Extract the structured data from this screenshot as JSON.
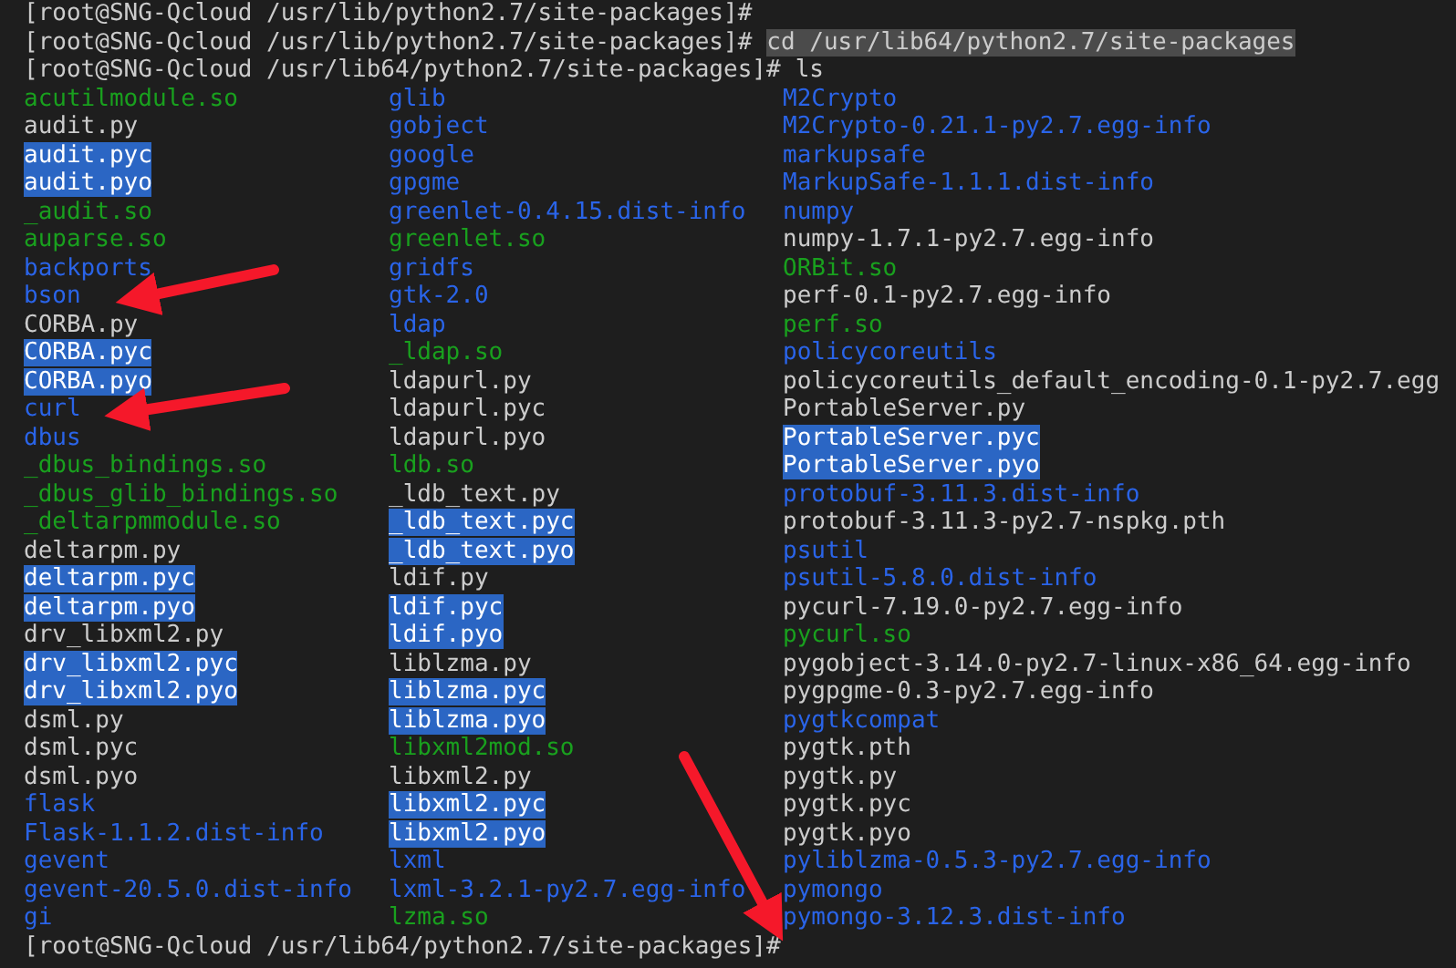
{
  "terminal": {
    "lines": [
      {
        "prompt": "[root@SNG-Qcloud /usr/lib/python2.7/site-packages]#"
      },
      {
        "prompt": "[root@SNG-Qcloud /usr/lib/python2.7/site-packages]#",
        "command": "cd /usr/lib64/python2.7/site-packages",
        "selected": true
      },
      {
        "prompt": "[root@SNG-Qcloud /usr/lib64/python2.7/site-packages]#",
        "command": "ls",
        "selected": false
      }
    ],
    "listing": [
      [
        {
          "name": "acutilmodule.so",
          "kind": "library"
        },
        {
          "name": "audit.py",
          "kind": "file"
        },
        {
          "name": "audit.pyc",
          "kind": "compiled"
        },
        {
          "name": "audit.pyo",
          "kind": "compiled"
        },
        {
          "name": "_audit.so",
          "kind": "library"
        },
        {
          "name": "auparse.so",
          "kind": "library"
        },
        {
          "name": "backports",
          "kind": "directory"
        },
        {
          "name": "bson",
          "kind": "directory"
        },
        {
          "name": "CORBA.py",
          "kind": "file"
        },
        {
          "name": "CORBA.pyc",
          "kind": "compiled"
        },
        {
          "name": "CORBA.pyo",
          "kind": "compiled"
        },
        {
          "name": "curl",
          "kind": "directory"
        },
        {
          "name": "dbus",
          "kind": "directory"
        },
        {
          "name": "_dbus_bindings.so",
          "kind": "library"
        },
        {
          "name": "_dbus_glib_bindings.so",
          "kind": "library"
        },
        {
          "name": "_deltarpmmodule.so",
          "kind": "library"
        },
        {
          "name": "deltarpm.py",
          "kind": "file"
        },
        {
          "name": "deltarpm.pyc",
          "kind": "compiled"
        },
        {
          "name": "deltarpm.pyo",
          "kind": "compiled"
        },
        {
          "name": "drv_libxml2.py",
          "kind": "file"
        },
        {
          "name": "drv_libxml2.pyc",
          "kind": "compiled"
        },
        {
          "name": "drv_libxml2.pyo",
          "kind": "compiled"
        },
        {
          "name": "dsml.py",
          "kind": "file"
        },
        {
          "name": "dsml.pyc",
          "kind": "file"
        },
        {
          "name": "dsml.pyo",
          "kind": "file"
        },
        {
          "name": "flask",
          "kind": "directory"
        },
        {
          "name": "Flask-1.1.2.dist-info",
          "kind": "directory"
        },
        {
          "name": "gevent",
          "kind": "directory"
        },
        {
          "name": "gevent-20.5.0.dist-info",
          "kind": "directory"
        },
        {
          "name": "gi",
          "kind": "directory"
        }
      ],
      [
        {
          "name": "glib",
          "kind": "directory"
        },
        {
          "name": "gobject",
          "kind": "directory"
        },
        {
          "name": "google",
          "kind": "directory"
        },
        {
          "name": "gpgme",
          "kind": "directory"
        },
        {
          "name": "greenlet-0.4.15.dist-info",
          "kind": "directory"
        },
        {
          "name": "greenlet.so",
          "kind": "library"
        },
        {
          "name": "gridfs",
          "kind": "directory"
        },
        {
          "name": "gtk-2.0",
          "kind": "directory"
        },
        {
          "name": "ldap",
          "kind": "directory"
        },
        {
          "name": "_ldap.so",
          "kind": "library"
        },
        {
          "name": "ldapurl.py",
          "kind": "file"
        },
        {
          "name": "ldapurl.pyc",
          "kind": "file"
        },
        {
          "name": "ldapurl.pyo",
          "kind": "file"
        },
        {
          "name": "ldb.so",
          "kind": "library"
        },
        {
          "name": "_ldb_text.py",
          "kind": "file"
        },
        {
          "name": "_ldb_text.pyc",
          "kind": "compiled"
        },
        {
          "name": "_ldb_text.pyo",
          "kind": "compiled"
        },
        {
          "name": "ldif.py",
          "kind": "file"
        },
        {
          "name": "ldif.pyc",
          "kind": "compiled"
        },
        {
          "name": "ldif.pyo",
          "kind": "compiled"
        },
        {
          "name": "liblzma.py",
          "kind": "file"
        },
        {
          "name": "liblzma.pyc",
          "kind": "compiled"
        },
        {
          "name": "liblzma.pyo",
          "kind": "compiled"
        },
        {
          "name": "libxml2mod.so",
          "kind": "library"
        },
        {
          "name": "libxml2.py",
          "kind": "file"
        },
        {
          "name": "libxml2.pyc",
          "kind": "compiled"
        },
        {
          "name": "libxml2.pyo",
          "kind": "compiled"
        },
        {
          "name": "lxml",
          "kind": "directory"
        },
        {
          "name": "lxml-3.2.1-py2.7.egg-info",
          "kind": "directory"
        },
        {
          "name": "lzma.so",
          "kind": "library"
        }
      ],
      [
        {
          "name": "M2Crypto",
          "kind": "directory"
        },
        {
          "name": "M2Crypto-0.21.1-py2.7.egg-info",
          "kind": "directory"
        },
        {
          "name": "markupsafe",
          "kind": "directory"
        },
        {
          "name": "MarkupSafe-1.1.1.dist-info",
          "kind": "directory"
        },
        {
          "name": "numpy",
          "kind": "directory"
        },
        {
          "name": "numpy-1.7.1-py2.7.egg-info",
          "kind": "file"
        },
        {
          "name": "ORBit.so",
          "kind": "library"
        },
        {
          "name": "perf-0.1-py2.7.egg-info",
          "kind": "file"
        },
        {
          "name": "perf.so",
          "kind": "library"
        },
        {
          "name": "policycoreutils",
          "kind": "directory"
        },
        {
          "name": "policycoreutils_default_encoding-0.1-py2.7.egg",
          "kind": "file"
        },
        {
          "name": "PortableServer.py",
          "kind": "file"
        },
        {
          "name": "PortableServer.pyc",
          "kind": "compiled"
        },
        {
          "name": "PortableServer.pyo",
          "kind": "compiled"
        },
        {
          "name": "protobuf-3.11.3.dist-info",
          "kind": "directory"
        },
        {
          "name": "protobuf-3.11.3-py2.7-nspkg.pth",
          "kind": "file"
        },
        {
          "name": "psutil",
          "kind": "directory"
        },
        {
          "name": "psutil-5.8.0.dist-info",
          "kind": "directory"
        },
        {
          "name": "pycurl-7.19.0-py2.7.egg-info",
          "kind": "file"
        },
        {
          "name": "pycurl.so",
          "kind": "library"
        },
        {
          "name": "pygobject-3.14.0-py2.7-linux-x86_64.egg-info",
          "kind": "file"
        },
        {
          "name": "pygpgme-0.3-py2.7.egg-info",
          "kind": "file"
        },
        {
          "name": "pygtkcompat",
          "kind": "directory"
        },
        {
          "name": "pygtk.pth",
          "kind": "file"
        },
        {
          "name": "pygtk.py",
          "kind": "file"
        },
        {
          "name": "pygtk.pyc",
          "kind": "file"
        },
        {
          "name": "pygtk.pyo",
          "kind": "file"
        },
        {
          "name": "pyliblzma-0.5.3-py2.7.egg-info",
          "kind": "directory"
        },
        {
          "name": "pymongo",
          "kind": "directory"
        },
        {
          "name": "pymongo-3.12.3.dist-info",
          "kind": "directory"
        }
      ]
    ],
    "final_prompt": "[root@SNG-Qcloud /usr/lib64/python2.7/site-packages]#"
  }
}
